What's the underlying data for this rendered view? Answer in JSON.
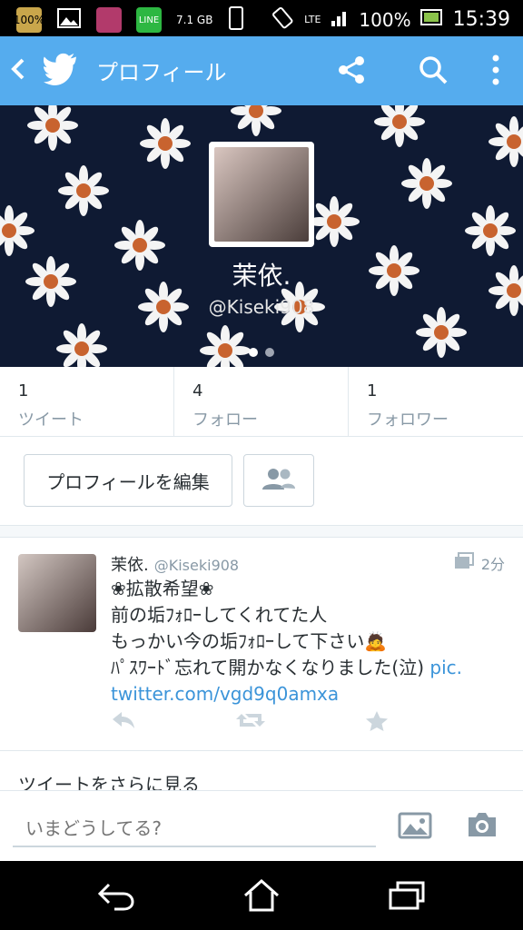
{
  "status_bar": {
    "battery_indicator_text": "100%",
    "storage": "7.1 GB",
    "battery_percent": "100%",
    "time": "15:39",
    "network": "LTE"
  },
  "app_bar": {
    "title": "プロフィール"
  },
  "profile": {
    "display_name": "茉依.",
    "screen_name": "@Kiseki908"
  },
  "stats": {
    "tweets": {
      "count": "1",
      "label": "ツイート"
    },
    "following": {
      "count": "4",
      "label": "フォロー"
    },
    "followers": {
      "count": "1",
      "label": "フォロワー"
    }
  },
  "actions": {
    "edit_profile_label": "プロフィールを編集"
  },
  "tweet": {
    "display_name": "茉依.",
    "handle": "@Kiseki908",
    "time": "2分",
    "lines": [
      "❀拡散希望❀",
      "前の垢ﾌｫﾛｰしてくれてた人",
      "もっかい今の垢ﾌｫﾛｰして下さい🙇",
      "ﾊﾟｽﾜｰﾄﾞ忘れて開かなくなりました(泣)"
    ],
    "link_part1": "pic.",
    "link_part2": "twitter.com/vgd9q0amxa"
  },
  "more_tweets_label": "ツイートをさらに見る",
  "composer": {
    "placeholder": "いまどうしてる?"
  },
  "colors": {
    "twitter_blue": "#55acee",
    "link_blue": "#3b94d9",
    "text": "#292f33",
    "muted": "#8899a6"
  }
}
